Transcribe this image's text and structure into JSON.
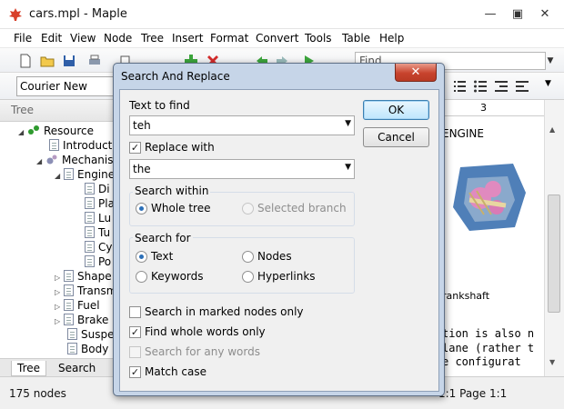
{
  "window": {
    "title": "cars.mpl - Maple"
  },
  "menu": [
    "File",
    "Edit",
    "View",
    "Node",
    "Tree",
    "Insert",
    "Format",
    "Convert",
    "Tools",
    "Table",
    "Help"
  ],
  "toolbar": {
    "find_placeholder": "Find...",
    "font": "Courier New"
  },
  "tree": {
    "header": "Tree",
    "rows": [
      {
        "label": "Resource",
        "level": 0
      },
      {
        "label": "Introductio",
        "level": 1
      },
      {
        "label": "Mechanism",
        "level": 1
      },
      {
        "label": "Engine",
        "level": 2
      },
      {
        "label": "Di",
        "level": 3
      },
      {
        "label": "Pla",
        "level": 3
      },
      {
        "label": "Lu",
        "level": 3
      },
      {
        "label": "Tu",
        "level": 3
      },
      {
        "label": "Cy",
        "level": 3
      },
      {
        "label": "Po",
        "level": 3
      },
      {
        "label": "Shape",
        "level": 2
      },
      {
        "label": "Transm",
        "level": 2
      },
      {
        "label": "Fuel",
        "level": 2
      },
      {
        "label": "Brake",
        "level": 2
      },
      {
        "label": "Suspe",
        "level": 2
      },
      {
        "label": "Body",
        "level": 2
      }
    ],
    "tabs": [
      "Tree",
      "Search Resu"
    ]
  },
  "document": {
    "ruler_mark": "3",
    "heading": "ENGINE",
    "caption": "rankshaft",
    "lines": [
      "tion is also n",
      "lane (rather t",
      "e configurat"
    ]
  },
  "status": {
    "nodes": "175 nodes",
    "position": "1:1 Page 1:1"
  },
  "dialog": {
    "title": "Search And Replace",
    "text_to_find_label": "Text to find",
    "text_to_find_value": "teh",
    "replace_with_label": "Replace with",
    "replace_with_value": "the",
    "ok": "OK",
    "cancel": "Cancel",
    "search_within_label": "Search within",
    "whole_tree": "Whole tree",
    "selected_branch": "Selected branch",
    "search_for_label": "Search for",
    "text": "Text",
    "nodes": "Nodes",
    "keywords": "Keywords",
    "hyperlinks": "Hyperlinks",
    "marked_only": "Search in marked nodes only",
    "whole_words": "Find whole words only",
    "any_words": "Search for any words",
    "match_case": "Match case"
  },
  "colors": {
    "dialog_frame": "#c6d5e8",
    "close_button": "#c8432d",
    "selection_blue": "#2b6fb8"
  }
}
